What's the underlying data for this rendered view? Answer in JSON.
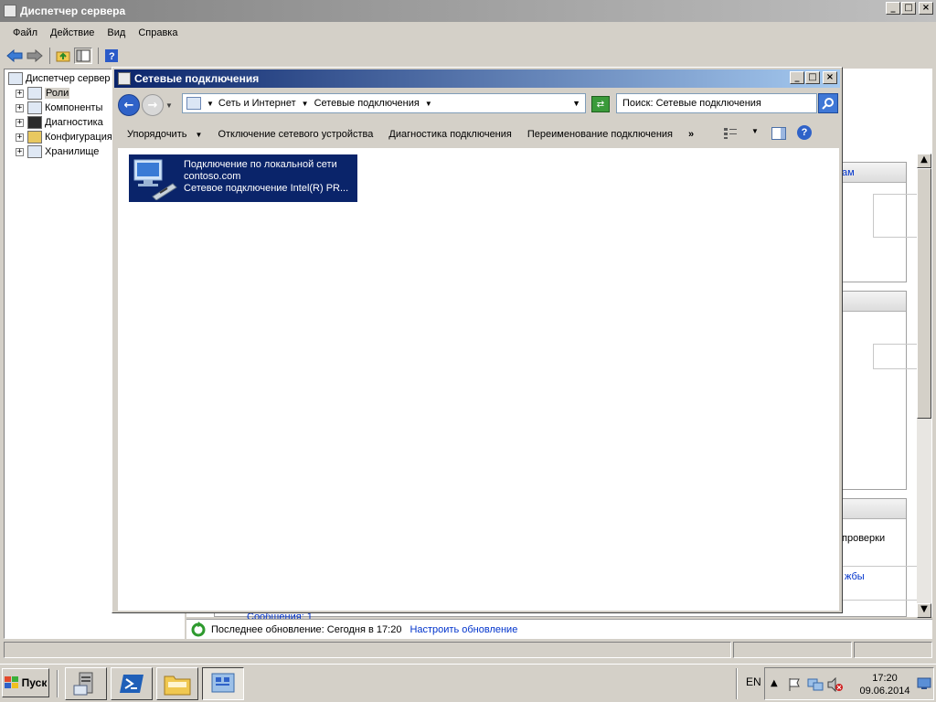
{
  "main_window": {
    "title": "Диспетчер сервера",
    "menu": [
      "Файл",
      "Действие",
      "Вид",
      "Справка"
    ],
    "tree": {
      "root": "Диспетчер сервер",
      "items": [
        "Роли",
        "Компоненты",
        "Диагностика",
        "Конфигурация",
        "Хранилище"
      ]
    },
    "right_fragments": {
      "link_1": "ам",
      "text_1": "проверки",
      "link_2": "жбы",
      "bottom_link": "Сообщения: 1"
    },
    "status": {
      "last_update": "Последнее обновление: Сегодня в 17:20",
      "configure_link": "Настроить обновление"
    }
  },
  "network_window": {
    "title": "Сетевые подключения",
    "breadcrumb": [
      "Сеть и Интернет",
      "Сетевые подключения"
    ],
    "search_placeholder": "Поиск: Сетевые подключения",
    "commands": [
      "Упорядочить",
      "Отключение сетевого устройства",
      "Диагностика подключения",
      "Переименование подключения"
    ],
    "more": "»",
    "connection": {
      "name": "Подключение по локальной сети",
      "domain": "contoso.com",
      "adapter": "Сетевое подключение Intel(R) PR..."
    }
  },
  "taskbar": {
    "start_label": "Пуск",
    "language": "EN",
    "time": "17:20",
    "date": "09.06.2014"
  },
  "colors": {
    "selection": "#0a246a",
    "link": "#0033cc",
    "title_active": "#0a246a",
    "title_inactive": "#808080"
  }
}
